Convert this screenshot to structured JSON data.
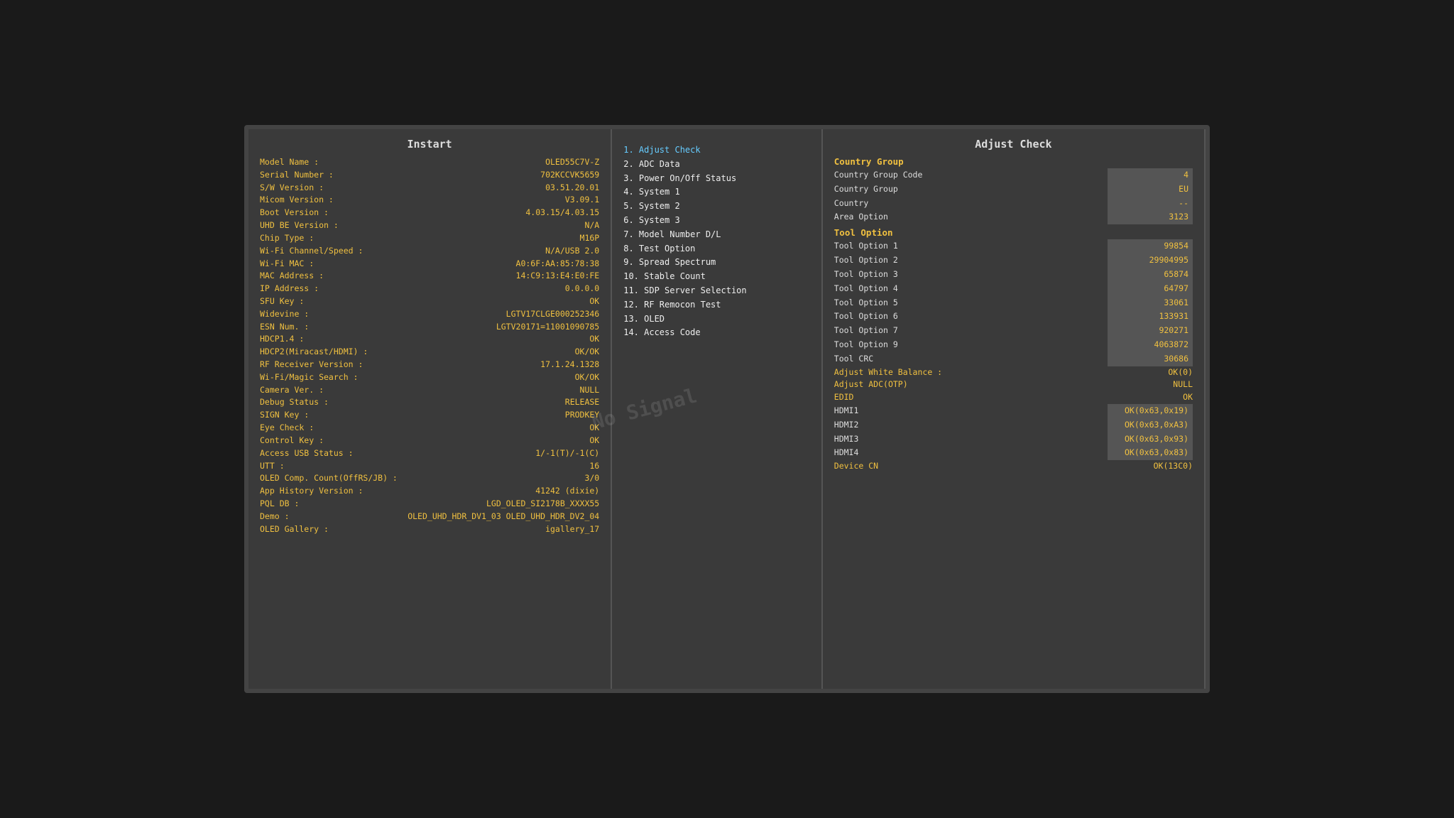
{
  "left": {
    "title": "Instart",
    "rows": [
      {
        "label": "Model Name :",
        "value": "OLED55C7V-Z"
      },
      {
        "label": "Serial Number :",
        "value": "702KCCVK5659"
      },
      {
        "label": "S/W Version :",
        "value": "03.51.20.01"
      },
      {
        "label": "Micom Version :",
        "value": "V3.09.1"
      },
      {
        "label": "Boot Version :",
        "value": "4.03.15/4.03.15"
      },
      {
        "label": "UHD BE Version :",
        "value": "N/A"
      },
      {
        "label": "Chip Type :",
        "value": "M16P"
      },
      {
        "label": "Wi-Fi Channel/Speed :",
        "value": "N/A/USB 2.0"
      },
      {
        "label": "Wi-Fi MAC :",
        "value": "A0:6F:AA:85:78:38"
      },
      {
        "label": "MAC Address :",
        "value": "14:C9:13:E4:E0:FE"
      },
      {
        "label": "IP Address :",
        "value": "0.0.0.0"
      },
      {
        "label": "SFU Key :",
        "value": "OK"
      },
      {
        "label": "Widevine :",
        "value": "LGTV17CLGE000252346"
      },
      {
        "label": "ESN Num. :",
        "value": "LGTV20171=11001090785"
      },
      {
        "label": "HDCP1.4 :",
        "value": "OK"
      },
      {
        "label": "HDCP2(Miracast/HDMI) :",
        "value": "OK/OK"
      },
      {
        "label": "RF Receiver Version :",
        "value": "17.1.24.1328"
      },
      {
        "label": "Wi-Fi/Magic Search :",
        "value": "OK/OK"
      },
      {
        "label": "Camera Ver. :",
        "value": "NULL"
      },
      {
        "label": "Debug Status :",
        "value": "RELEASE"
      },
      {
        "label": "SIGN Key :",
        "value": "PRODKEY"
      },
      {
        "label": "Eye Check :",
        "value": "OK"
      },
      {
        "label": "Control Key :",
        "value": "OK"
      },
      {
        "label": "Access USB Status :",
        "value": "1/-1(T)/-1(C)"
      },
      {
        "label": "UTT :",
        "value": "16"
      },
      {
        "label": "OLED Comp. Count(OffRS/JB) :",
        "value": "3/0"
      },
      {
        "label": "App History Version :",
        "value": "41242 (dixie)"
      },
      {
        "label": "PQL DB :",
        "value": "LGD_OLED_SI2178B_XXXX55"
      },
      {
        "label": "Demo :",
        "value": "OLED_UHD_HDR_DV1_03 OLED_UHD_HDR_DV2_04"
      },
      {
        "label": "OLED Gallery :",
        "value": "igallery_17"
      }
    ]
  },
  "middle": {
    "title": "Adjust Check",
    "items": [
      {
        "num": "1.",
        "label": "Adjust Check",
        "active": true
      },
      {
        "num": "2.",
        "label": "ADC Data",
        "active": false
      },
      {
        "num": "3.",
        "label": "Power On/Off Status",
        "active": false
      },
      {
        "num": "4.",
        "label": "System 1",
        "active": false
      },
      {
        "num": "5.",
        "label": "System 2",
        "active": false
      },
      {
        "num": "6.",
        "label": "System 3",
        "active": false
      },
      {
        "num": "7.",
        "label": "Model Number D/L",
        "active": false
      },
      {
        "num": "8.",
        "label": "Test Option",
        "active": false
      },
      {
        "num": "9.",
        "label": "Spread Spectrum",
        "active": false
      },
      {
        "num": "10.",
        "label": "Stable Count",
        "active": false
      },
      {
        "num": "11.",
        "label": "SDP Server Selection",
        "active": false
      },
      {
        "num": "12.",
        "label": "RF Remocon Test",
        "active": false
      },
      {
        "num": "13.",
        "label": "OLED",
        "active": false
      },
      {
        "num": "14.",
        "label": "Access Code",
        "active": false
      }
    ]
  },
  "right": {
    "title": "Adjust Check",
    "sections": [
      {
        "title": "Country Group",
        "rows": [
          {
            "label": "Country Group Code",
            "value": "4",
            "box": true,
            "yellow_label": false
          },
          {
            "label": "Country Group",
            "value": "EU",
            "box": true,
            "yellow_label": false
          },
          {
            "label": "Country",
            "value": "--",
            "box": true,
            "yellow_label": false
          },
          {
            "label": "Area Option",
            "value": "3123",
            "box": true,
            "yellow_label": false
          }
        ]
      },
      {
        "title": "Tool Option",
        "rows": [
          {
            "label": "Tool Option 1",
            "value": "99854",
            "box": true,
            "yellow_label": false
          },
          {
            "label": "Tool Option 2",
            "value": "29904995",
            "box": true,
            "yellow_label": false
          },
          {
            "label": "Tool Option 3",
            "value": "65874",
            "box": true,
            "yellow_label": false
          },
          {
            "label": "Tool Option 4",
            "value": "64797",
            "box": true,
            "yellow_label": false
          },
          {
            "label": "Tool Option 5",
            "value": "33061",
            "box": true,
            "yellow_label": false
          },
          {
            "label": "Tool Option 6",
            "value": "133931",
            "box": true,
            "yellow_label": false
          },
          {
            "label": "Tool Option 7",
            "value": "920271",
            "box": true,
            "yellow_label": false
          },
          {
            "label": "Tool Option 9",
            "value": "4063872",
            "box": true,
            "yellow_label": false
          },
          {
            "label": "Tool CRC",
            "value": "30686",
            "box": true,
            "yellow_label": false
          }
        ]
      },
      {
        "title": null,
        "rows": [
          {
            "label": "Adjust White Balance :",
            "value": "OK(0)",
            "box": false,
            "yellow_label": true,
            "yellow_value": true
          },
          {
            "label": "Adjust ADC(OTP)",
            "value": "NULL",
            "box": false,
            "yellow_label": true,
            "yellow_value": true
          },
          {
            "label": "EDID",
            "value": "OK",
            "box": false,
            "yellow_label": true,
            "yellow_value": true
          },
          {
            "label": "HDMI1",
            "value": "OK(0x63,0x19)",
            "box": true,
            "yellow_label": false
          },
          {
            "label": "HDMI2",
            "value": "OK(0x63,0xA3)",
            "box": true,
            "yellow_label": false
          },
          {
            "label": "HDMI3",
            "value": "OK(0x63,0x93)",
            "box": true,
            "yellow_label": false
          },
          {
            "label": "HDMI4",
            "value": "OK(0x63,0x83)",
            "box": true,
            "yellow_label": false
          }
        ]
      },
      {
        "title": null,
        "rows": [
          {
            "label": "Device CN",
            "value": "OK(13C0)",
            "box": false,
            "yellow_label": true,
            "yellow_value": true
          }
        ]
      }
    ]
  },
  "watermark": "No Signal"
}
